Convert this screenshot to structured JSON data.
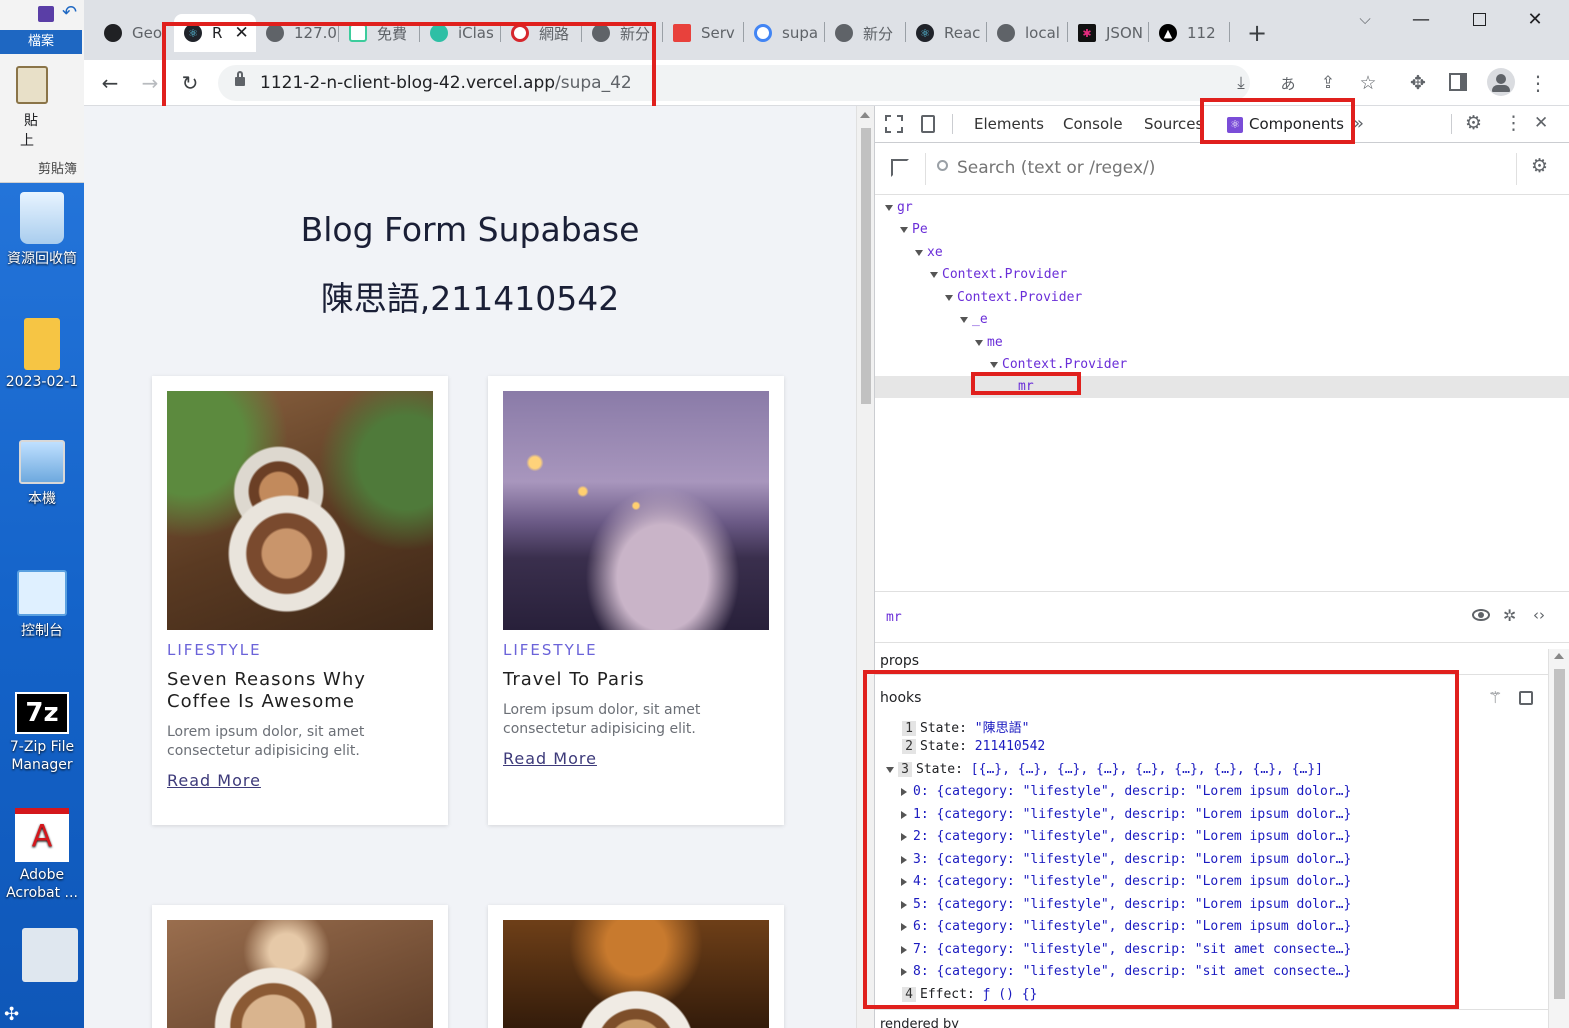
{
  "desktop": {
    "excel": {
      "file_tab": "檔案",
      "paste_label": "貼",
      "paste_sub": "上",
      "clipboard_group": "剪貼簿"
    },
    "icons": [
      {
        "name": "recycle-bin",
        "label": "資源回收筒"
      },
      {
        "name": "folder",
        "label": "2023-02-1"
      },
      {
        "name": "this-pc",
        "label": "本機"
      },
      {
        "name": "control-panel",
        "label": "控制台"
      },
      {
        "name": "7zip",
        "label": "7-Zip File Manager"
      },
      {
        "name": "adobe-acrobat",
        "label": "Adobe Acrobat ..."
      }
    ]
  },
  "browser": {
    "tabs": [
      {
        "label": "Geo",
        "icon": "github-icon"
      },
      {
        "label": "R",
        "icon": "react-icon",
        "active": true
      },
      {
        "label": "127.0",
        "icon": "globe-icon"
      },
      {
        "label": "免費",
        "icon": "square-icon"
      },
      {
        "label": "iClas",
        "icon": "iclass-icon"
      },
      {
        "label": "網路",
        "icon": "wifi-icon"
      },
      {
        "label": "新分",
        "icon": "chrome-icon"
      },
      {
        "label": "Serv",
        "icon": "server-icon"
      },
      {
        "label": "supa",
        "icon": "google-icon"
      },
      {
        "label": "新分",
        "icon": "chrome-icon"
      },
      {
        "label": "Reac",
        "icon": "react-icon"
      },
      {
        "label": "local",
        "icon": "globe-icon"
      },
      {
        "label": "JSON",
        "icon": "json-icon"
      },
      {
        "label": "112",
        "icon": "vercel-icon"
      }
    ],
    "url_domain": "1121-2-n-client-blog-42.vercel.app",
    "url_path": "/supa_42"
  },
  "page": {
    "title": "Blog Form Supabase",
    "subtitle": "陳思語,211410542",
    "cards": [
      {
        "category": "LIFESTYLE",
        "title": "Seven Reasons Why Coffee Is Awesome",
        "desc": "Lorem ipsum dolor, sit amet consectetur adipisicing elit.",
        "link": "Read More"
      },
      {
        "category": "LIFESTYLE",
        "title": "Travel To Paris",
        "desc": "Lorem ipsum dolor, sit amet consectetur adipisicing elit.",
        "link": "Read More"
      }
    ]
  },
  "devtools": {
    "tabs": {
      "elements": "Elements",
      "console": "Console",
      "sources": "Sources",
      "components": "Components"
    },
    "search_placeholder": "Search (text or /regex/)",
    "tree": [
      "gr",
      "Pe",
      "xe",
      "Context.Provider",
      "Context.Provider",
      "_e",
      "me",
      "Context.Provider",
      "mr"
    ],
    "selected_component": "mr",
    "props_label": "props",
    "hooks_label": "hooks",
    "hooks": {
      "h1_key": "State:",
      "h1_val": "\"陳思語\"",
      "h2_key": "State:",
      "h2_val": "211410542",
      "h3_key": "State:",
      "h3_val": "[{…}, {…}, {…}, {…}, {…}, {…}, {…}, {…}, {…}]",
      "items": [
        "0: {category: \"lifestyle\", descrip: \"Lorem ipsum dolor…}",
        "1: {category: \"lifestyle\", descrip: \"Lorem ipsum dolor…}",
        "2: {category: \"lifestyle\", descrip: \"Lorem ipsum dolor…}",
        "3: {category: \"lifestyle\", descrip: \"Lorem ipsum dolor…}",
        "4: {category: \"lifestyle\", descrip: \"Lorem ipsum dolor…}",
        "5: {category: \"lifestyle\", descrip: \"Lorem ipsum dolor…}",
        "6: {category: \"lifestyle\", descrip: \"Lorem ipsum dolor…}",
        "7: {category: \"lifestyle\", descrip: \"sit amet consecte…}",
        "8: {category: \"lifestyle\", descrip: \"sit amet consecte…}"
      ],
      "h4_key": "Effect:",
      "h4_val": "ƒ () {}"
    },
    "rendered_by": "rendered by"
  }
}
